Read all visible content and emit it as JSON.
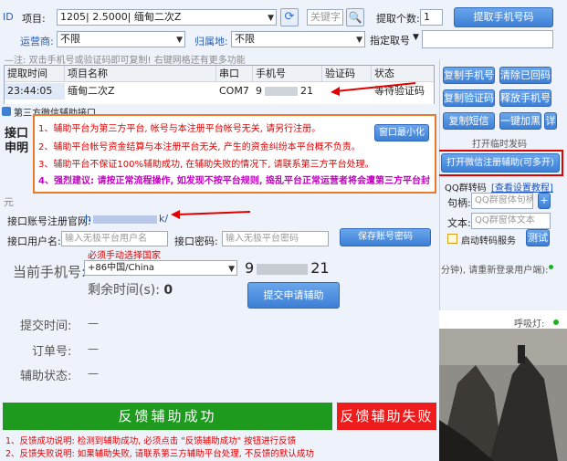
{
  "toolbar": {
    "id_label": "ID",
    "project_label": "项目:",
    "project_value": "1205| 2.5000| 缅甸二次Z",
    "keyword_placeholder": "关键字",
    "fetch_count_label": "提取个数:",
    "fetch_count_value": "1",
    "fetch_button": "提取手机号码",
    "operator_label": "运营商:",
    "operator_value": "不限",
    "location_label": "归属地:",
    "location_value": "不限",
    "assign_label": "指定取号"
  },
  "hint": "—注: 双击手机号或验证码即可复制! 右键网格还有更多功能",
  "table": {
    "headers": [
      "提取时间",
      "项目名称",
      "串口",
      "手机号",
      "验证码",
      "状态"
    ],
    "rows": [
      {
        "time": "23:44:05",
        "project": "缅甸二次Z",
        "port": "COM7",
        "phone_a": "9",
        "phone_b": "21",
        "code": "",
        "status": "等待验证码"
      }
    ]
  },
  "right_buttons": {
    "copy_phone": "复制手机号",
    "clear_recv": "清除已回码",
    "copy_code": "复制验证码",
    "release_phone": "释放手机号",
    "copy_sms": "复制短信",
    "release_all": "一键加黑",
    "detail": "详",
    "timer_label": "打开临时发码",
    "open_wechat": "打开微信注册辅助(可多开)"
  },
  "qq": {
    "title": "QQ群转码",
    "tutorial_link": "[查看设置教程]",
    "handle_label": "句柄:",
    "handle_placeholder": "QQ群窗体句柄",
    "text_label": "文本:",
    "text_placeholder": "QQ群窗体文本",
    "enable_label": "启动转码服务",
    "test_button": "测试",
    "status_note": "分钟), 请重新登录用户端):",
    "breath_label": "呼吸灯:"
  },
  "dialog": {
    "title": "第三方微信辅助接口",
    "side_title": "接口申明",
    "minimize_button": "窗口最小化",
    "notices": [
      "1、辅助平台为第三方平台, 帐号与本注册平台帐号无关, 请另行注册。",
      "2、辅助平台帐号资金结算与本注册平台无关, 产生的资金纠纷本平台概不负责。",
      "3、辅助平台不保证100%辅助成功, 在辅助失败的情况下, 请联系第三方平台处理。",
      "4、强烈建议: 请按正常流程操作, 如发现不按平台规则, 捣乱平台正常运营者将会遭第三方平台封"
    ],
    "url_label": "接口账号注册官网:",
    "url_value": "h",
    "url_tail": "k/",
    "username_label": "接口用户名:",
    "username_placeholder": "输入无极平台用户名",
    "password_label": "接口密码:",
    "password_placeholder": "输入无极平台密码",
    "save_button": "保存账号密码",
    "country_hint": "必须手动选择国家",
    "current_phone_label": "当前手机号:",
    "country_value": "+86中国/China",
    "current_phone_a": "9",
    "current_phone_b": "21",
    "remaining_label": "剩余时间(s):",
    "remaining_value": "0",
    "submit_button": "提交申请辅助",
    "submit_time_label": "提交时间:",
    "submit_time_value": "—",
    "order_label": "订单号:",
    "order_value": "—",
    "assist_status_label": "辅助状态:",
    "assist_status_value": "—",
    "success_button": "反馈辅助成功",
    "fail_button": "反馈辅助失败",
    "footer_notes": [
      "1、反馈成功说明: 检测到辅助成功, 必须点击 \"反馈辅助成功\" 按钮进行反馈",
      "2、反馈失败说明: 如果辅助失败, 请联系第三方辅助平台处理, 不反馈的默认成功"
    ]
  },
  "colors": {
    "accent": "#3d7fd6",
    "alert": "#e00000",
    "success": "#1e9b1e",
    "fail": "#ee1c1c"
  }
}
